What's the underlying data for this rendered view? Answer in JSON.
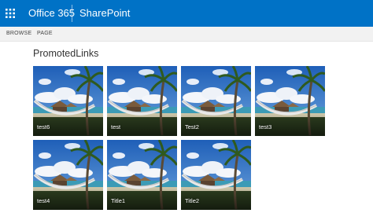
{
  "suite_bar": {
    "brand": "Office 365",
    "app": "SharePoint",
    "color": "#0072c6"
  },
  "ribbon": {
    "tabs": [
      "BROWSE",
      "PAGE"
    ]
  },
  "page": {
    "title": "PromotedLinks"
  },
  "tiles": [
    {
      "label": "test6"
    },
    {
      "label": "test"
    },
    {
      "label": "Test2"
    },
    {
      "label": "test3"
    },
    {
      "label": "test4"
    },
    {
      "label": "Title1"
    },
    {
      "label": "Title2"
    }
  ]
}
